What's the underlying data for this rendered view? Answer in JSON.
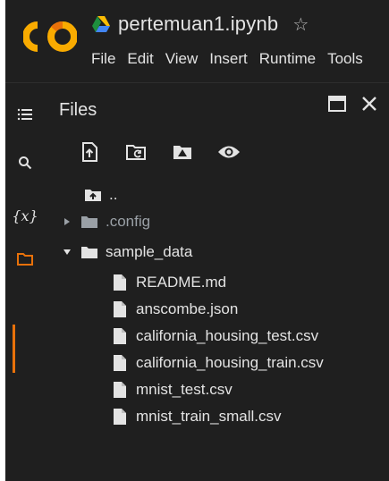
{
  "header": {
    "notebook_title": "pertemuan1.ipynb",
    "star_glyph": "☆",
    "menu": [
      "File",
      "Edit",
      "View",
      "Insert",
      "Runtime",
      "Tools"
    ]
  },
  "rail": {
    "items": [
      "toc-icon",
      "search-icon",
      "variables-icon",
      "folder-icon"
    ],
    "variables_label": "{x}"
  },
  "files": {
    "title": "Files",
    "toolbar": [
      "upload-icon",
      "refresh-folder-icon",
      "mount-drive-icon",
      "show-hidden-icon"
    ],
    "parent_label": "..",
    "tree": [
      {
        "name": ".config",
        "type": "folder",
        "expanded": false,
        "dim": true
      },
      {
        "name": "sample_data",
        "type": "folder",
        "expanded": true,
        "dim": false
      }
    ],
    "sample_files": [
      "README.md",
      "anscombe.json",
      "california_housing_test.csv",
      "california_housing_train.csv",
      "mnist_test.csv",
      "mnist_train_small.csv"
    ]
  },
  "colors": {
    "background": "#1f1f1f",
    "accent": "#e8710a",
    "text": "#e3e3e3",
    "dim_text": "#9aa0a6"
  }
}
